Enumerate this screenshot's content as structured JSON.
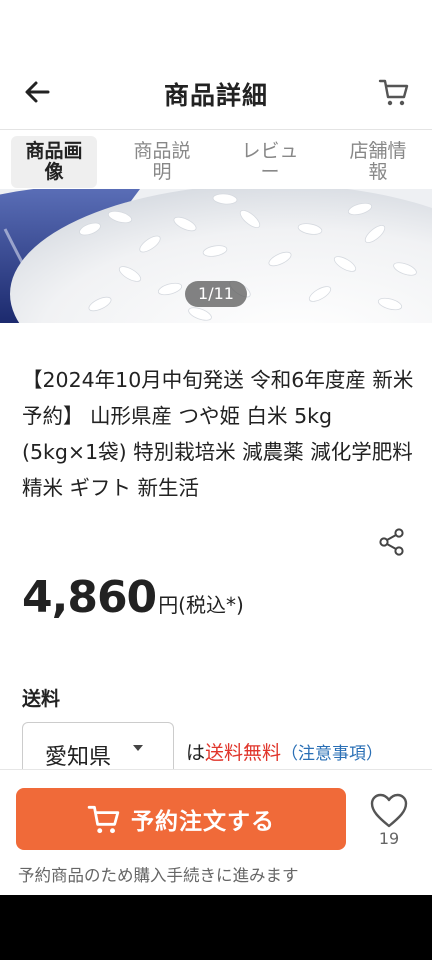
{
  "header": {
    "title": "商品詳細"
  },
  "tabs": [
    {
      "label": "商品画像"
    },
    {
      "label": "商品説明"
    },
    {
      "label": "レビュー"
    },
    {
      "label": "店舗情報"
    }
  ],
  "gallery": {
    "counter": "1/11"
  },
  "product": {
    "title": "【2024年10月中旬発送 令和6年度産 新米予約】 山形県産 つや姫 白米 5kg (5kg×1袋) 特別栽培米 減農薬 減化学肥料 精米 ギフト 新生活",
    "price": "4,860",
    "price_unit": "円(税込*)"
  },
  "shipping": {
    "label": "送料",
    "prefecture": "愛知県",
    "prefix": "は",
    "free_text": "送料無料",
    "note": "（注意事項）"
  },
  "bottom": {
    "order_label": "予約注文する",
    "favorite_count": "19",
    "notice": "予約商品のため購入手続きに進みます"
  },
  "colors": {
    "accent": "#f06a39",
    "free_shipping": "#e0352b",
    "link": "#2a6fb5"
  },
  "icons": [
    "back-arrow-icon",
    "cart-icon",
    "share-icon",
    "heart-icon"
  ]
}
